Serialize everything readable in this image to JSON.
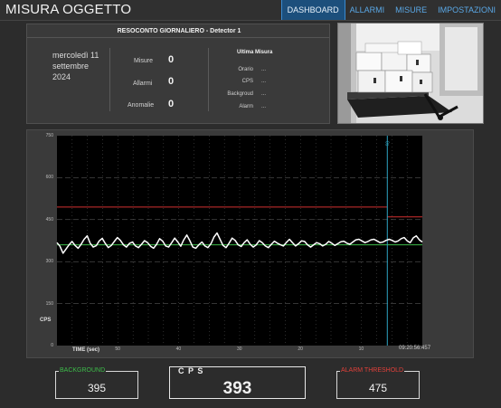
{
  "header": {
    "title": "MISURA OGGETTO"
  },
  "nav": [
    {
      "label": "DASHBOARD",
      "active": true
    },
    {
      "label": "ALLARMI",
      "active": false
    },
    {
      "label": "MISURE",
      "active": false
    },
    {
      "label": "IMPOSTAZIONI",
      "active": false
    }
  ],
  "report": {
    "title": "RESOCONTO GIORNALIERO - Detector 1",
    "date_lines": [
      "mercoledì 11",
      "settembre",
      "2024"
    ],
    "metrics": [
      {
        "label": "Misure",
        "value": "0"
      },
      {
        "label": "Allarmi",
        "value": "0"
      },
      {
        "label": "Anomalie",
        "value": "0"
      }
    ],
    "last_measure": {
      "title": "Ultima Misura",
      "rows": [
        {
          "label": "Orario",
          "value": "..."
        },
        {
          "label": "CPS",
          "value": "..."
        },
        {
          "label": "Backgroud",
          "value": "..."
        },
        {
          "label": "Alarm",
          "value": "..."
        }
      ]
    }
  },
  "chart": {
    "xlabel": "TIME (sec)",
    "ylabel": "CPS",
    "time_label": "09:20:56:457",
    "cursor_label": "0s"
  },
  "chart_data": {
    "type": "line",
    "ylim": [
      0,
      750
    ],
    "xlim": [
      0,
      120
    ],
    "y_ticks": [
      "750",
      "600",
      "450",
      "300",
      "150",
      "0"
    ],
    "x_ticks": [
      {
        "x": 20,
        "label": "50"
      },
      {
        "x": 40,
        "label": "40"
      },
      {
        "x": 60,
        "label": "30"
      },
      {
        "x": 80,
        "label": "20"
      },
      {
        "x": 100,
        "label": "10"
      }
    ],
    "grid": true,
    "cursor_x": 108.5,
    "series": [
      {
        "name": "CPS",
        "color": "#ffffff",
        "values": [
          368,
          355,
          330,
          345,
          360,
          372,
          358,
          348,
          362,
          380,
          392,
          366,
          352,
          357,
          374,
          383,
          365,
          350,
          358,
          372,
          386,
          376,
          360,
          352,
          365,
          370,
          356,
          350,
          362,
          375,
          368,
          355,
          348,
          362,
          382,
          373,
          356,
          352,
          368,
          384,
          370,
          355,
          378,
          395,
          375,
          352,
          348,
          360,
          370,
          356,
          350,
          364,
          388,
          402,
          380,
          358,
          350,
          366,
          384,
          376,
          360,
          354,
          368,
          378,
          362,
          352,
          360,
          375,
          368,
          356,
          350,
          362,
          373,
          366,
          360,
          356,
          369,
          380,
          368,
          356,
          364,
          374,
          372,
          360,
          352,
          360,
          368,
          364,
          356,
          362,
          372,
          366,
          358,
          364,
          371,
          373,
          366,
          362,
          370,
          378,
          380,
          374,
          368,
          372,
          378,
          380,
          374,
          368,
          370,
          376,
          380,
          376,
          370,
          374,
          382,
          386,
          374,
          368,
          385,
          392,
          378,
          370
        ]
      },
      {
        "name": "ALARM THRESHOLD",
        "color": "#d23030",
        "steps": [
          {
            "x": [
              0,
              108.5
            ],
            "y": 495
          },
          {
            "x": [
              108.5,
              120
            ],
            "y": 460
          }
        ]
      },
      {
        "name": "BACKGROUND",
        "color": "#3dbb4a",
        "steps": [
          {
            "x": [
              0,
              120
            ],
            "y": 360
          }
        ]
      }
    ]
  },
  "readouts": {
    "background": {
      "label": "BACKGROUND",
      "value": "395",
      "color": "#3dbb4a"
    },
    "cps": {
      "label": "C P S",
      "value": "393"
    },
    "alarm": {
      "label": "ALARM THRESHOLD",
      "value": "475",
      "color": "#e0403a"
    }
  }
}
